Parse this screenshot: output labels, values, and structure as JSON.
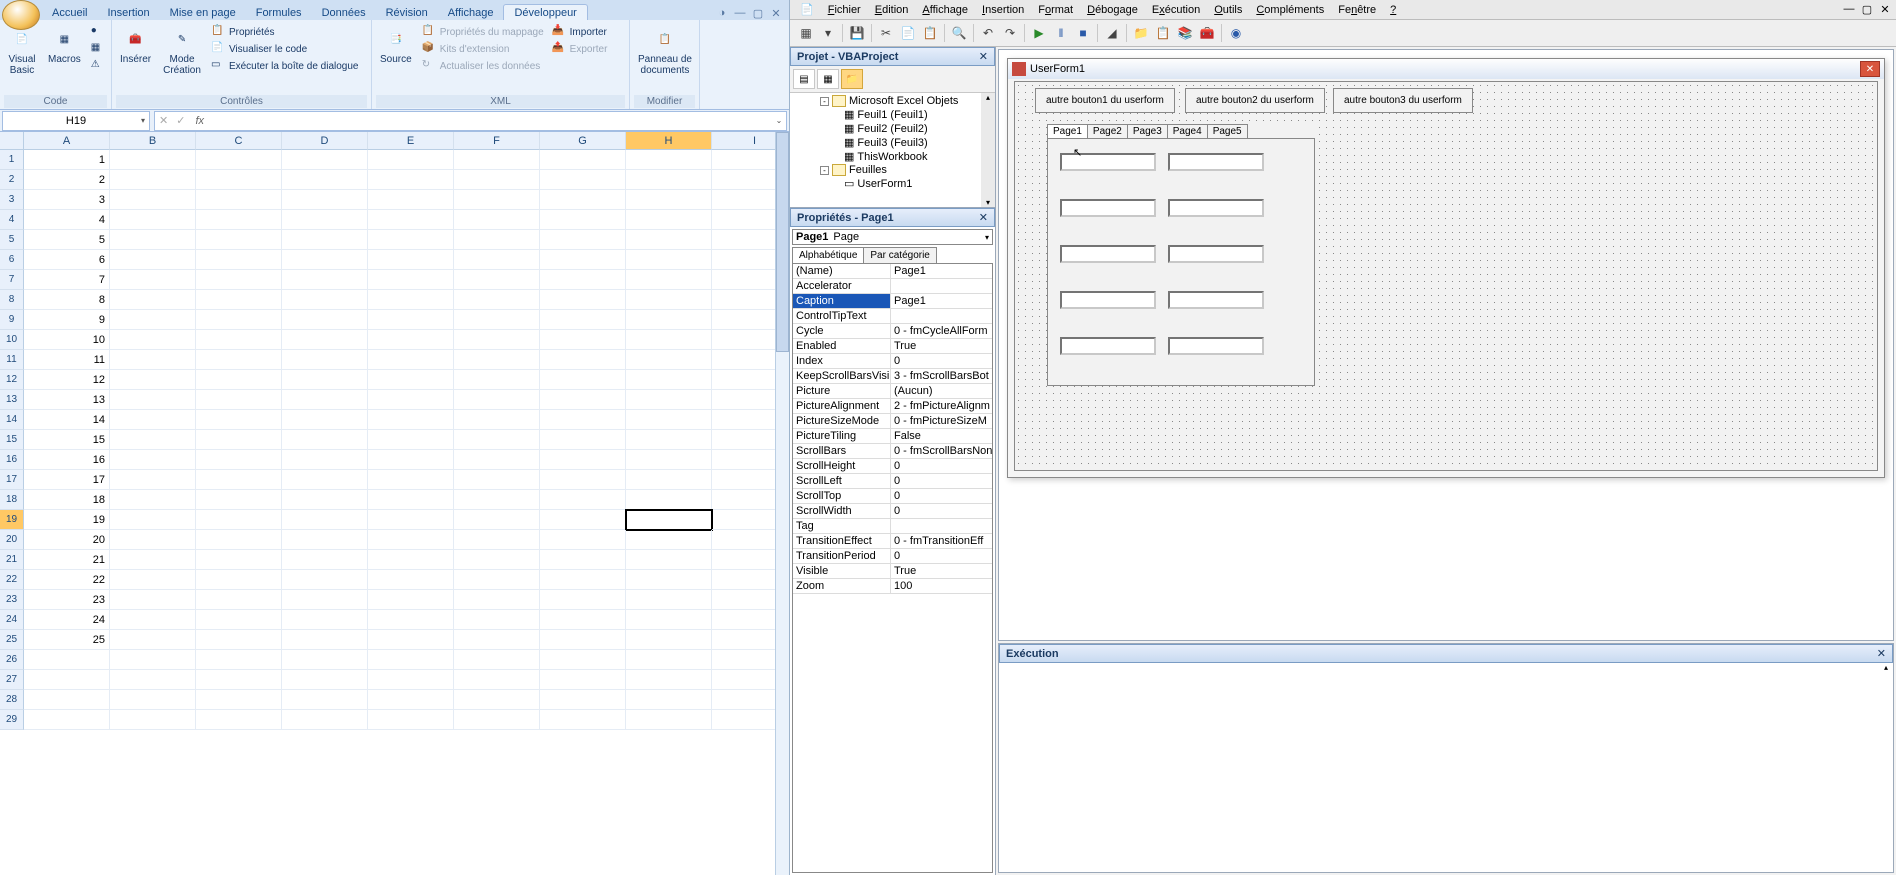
{
  "excel": {
    "tabs": [
      "Accueil",
      "Insertion",
      "Mise en page",
      "Formules",
      "Données",
      "Révision",
      "Affichage",
      "Développeur"
    ],
    "active_tab": "Développeur",
    "groups": {
      "code": {
        "label": "Code",
        "visual_basic": "Visual\nBasic",
        "macros": "Macros"
      },
      "controles": {
        "label": "Contrôles",
        "inserer": "Insérer",
        "mode_creation": "Mode\nCréation",
        "proprietes": "Propriétés",
        "visualiser": "Visualiser le code",
        "boite": "Exécuter la boîte de dialogue"
      },
      "xml": {
        "label": "XML",
        "source": "Source",
        "mappage": "Propriétés du mappage",
        "kits": "Kits d'extension",
        "actualiser": "Actualiser les données",
        "importer": "Importer",
        "exporter": "Exporter"
      },
      "modifier": {
        "label": "Modifier",
        "panneau": "Panneau de\ndocuments"
      }
    },
    "namebox": "H19",
    "columns": [
      "A",
      "B",
      "C",
      "D",
      "E",
      "F",
      "G",
      "H",
      "I"
    ],
    "active_col": "H",
    "rows": 29,
    "active_row": 19,
    "colA": {
      "1": "1",
      "2": "2",
      "3": "3",
      "4": "4",
      "5": "5",
      "6": "6",
      "7": "7",
      "8": "8",
      "9": "9",
      "10": "10",
      "11": "11",
      "12": "12",
      "13": "13",
      "14": "14",
      "15": "15",
      "16": "16",
      "17": "17",
      "18": "18",
      "19": "19",
      "20": "20",
      "21": "21",
      "22": "22",
      "23": "23",
      "24": "24",
      "25": "25"
    }
  },
  "vbe": {
    "menus": [
      "Fichier",
      "Edition",
      "Affichage",
      "Insertion",
      "Format",
      "Débogage",
      "Exécution",
      "Outils",
      "Compléments",
      "Fenêtre",
      "?"
    ],
    "project_title": "Projet - VBAProject",
    "tree": {
      "objets": "Microsoft Excel Objets",
      "f1": "Feuil1 (Feuil1)",
      "f2": "Feuil2 (Feuil2)",
      "f3": "Feuil3 (Feuil3)",
      "wb": "ThisWorkbook",
      "feuilles": "Feuilles",
      "uf": "UserForm1"
    },
    "props_title": "Propriétés - Page1",
    "props_object": "Page1",
    "props_type": "Page",
    "props_tab_alpha": "Alphabétique",
    "props_tab_cat": "Par catégorie",
    "props": [
      {
        "k": "(Name)",
        "v": "Page1"
      },
      {
        "k": "Accelerator",
        "v": ""
      },
      {
        "k": "Caption",
        "v": "Page1",
        "sel": true
      },
      {
        "k": "ControlTipText",
        "v": ""
      },
      {
        "k": "Cycle",
        "v": "0 - fmCycleAllForm"
      },
      {
        "k": "Enabled",
        "v": "True"
      },
      {
        "k": "Index",
        "v": "0"
      },
      {
        "k": "KeepScrollBarsVisible",
        "v": "3 - fmScrollBarsBot"
      },
      {
        "k": "Picture",
        "v": "(Aucun)"
      },
      {
        "k": "PictureAlignment",
        "v": "2 - fmPictureAlignm"
      },
      {
        "k": "PictureSizeMode",
        "v": "0 - fmPictureSizeM"
      },
      {
        "k": "PictureTiling",
        "v": "False"
      },
      {
        "k": "ScrollBars",
        "v": "0 - fmScrollBarsNon"
      },
      {
        "k": "ScrollHeight",
        "v": "0"
      },
      {
        "k": "ScrollLeft",
        "v": "0"
      },
      {
        "k": "ScrollTop",
        "v": "0"
      },
      {
        "k": "ScrollWidth",
        "v": "0"
      },
      {
        "k": "Tag",
        "v": ""
      },
      {
        "k": "TransitionEffect",
        "v": "0 - fmTransitionEff"
      },
      {
        "k": "TransitionPeriod",
        "v": "0"
      },
      {
        "k": "Visible",
        "v": "True"
      },
      {
        "k": "Zoom",
        "v": "100"
      }
    ],
    "uf_title": "UserForm1",
    "uf_buttons": [
      "autre bouton1 du userform",
      "autre bouton2 du userform",
      "autre bouton3 du userform"
    ],
    "mp_tabs": [
      "Page1",
      "Page2",
      "Page3",
      "Page4",
      "Page5"
    ],
    "exec_title": "Exécution"
  }
}
